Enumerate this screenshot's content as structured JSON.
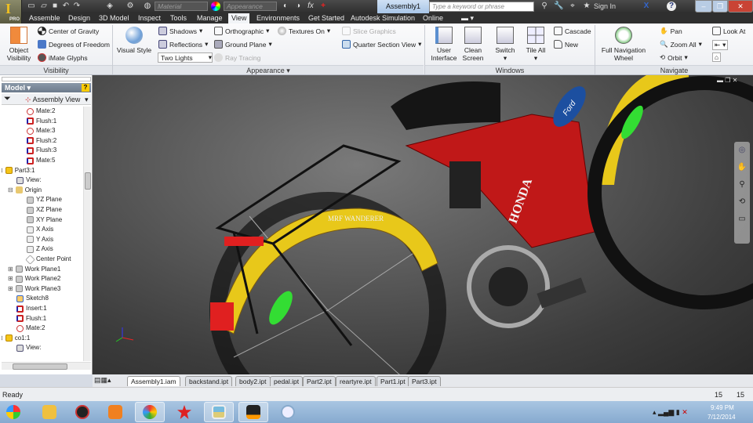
{
  "titlebar": {
    "app_badge": "PRO",
    "material_placeholder": "Material",
    "appearance_placeholder": "Appearance",
    "document_title": "Assembly1",
    "search_placeholder": "Type a keyword or phrase",
    "sign_in": "Sign In"
  },
  "tabs": [
    "Assemble",
    "Design",
    "3D Model",
    "Inspect",
    "Tools",
    "Manage",
    "View",
    "Environments",
    "Get Started",
    "Autodesk Simulation",
    "Online"
  ],
  "active_tab": "View",
  "ribbon": {
    "visibility": {
      "label": "Visibility",
      "object_visibility": "Object Visibility",
      "center_of_gravity": "Center of Gravity",
      "degrees_of_freedom": "Degrees of Freedom",
      "imate_glyphs": "iMate Glyphs"
    },
    "appearance": {
      "label": "Appearance",
      "visual_style": "Visual Style",
      "shadows": "Shadows",
      "reflections": "Reflections",
      "lighting": "Two Lights",
      "orthographic": "Orthographic",
      "ground_plane": "Ground Plane",
      "ray_tracing": "Ray Tracing",
      "textures_on": "Textures On",
      "slice_graphics": "Slice Graphics",
      "quarter_section_view": "Quarter Section View"
    },
    "windows": {
      "label": "Windows",
      "user_interface": "User Interface",
      "clean_screen": "Clean Screen",
      "switch": "Switch",
      "tile_all": "Tile All",
      "cascade": "Cascade",
      "new": "New"
    },
    "navigate": {
      "label": "Navigate",
      "full_navigation_wheel": "Full Navigation Wheel",
      "pan": "Pan",
      "zoom_all": "Zoom All",
      "orbit": "Orbit",
      "look_at": "Look At"
    }
  },
  "browser": {
    "title": "Model",
    "view": "Assembly View",
    "items": [
      {
        "label": "Mate:2",
        "level": 2,
        "icon": "mate"
      },
      {
        "label": "Flush:1",
        "level": 2,
        "icon": "flush"
      },
      {
        "label": "Mate:3",
        "level": 2,
        "icon": "mate"
      },
      {
        "label": "Flush:2",
        "level": 2,
        "icon": "flush"
      },
      {
        "label": "Flush:3",
        "level": 2,
        "icon": "flush"
      },
      {
        "label": "Mate:5",
        "level": 2,
        "icon": "flush"
      },
      {
        "label": "Part3:1",
        "level": 0,
        "icon": "part"
      },
      {
        "label": "View:",
        "level": 1,
        "icon": "view"
      },
      {
        "label": "Origin",
        "level": 1,
        "icon": "folder"
      },
      {
        "label": "YZ Plane",
        "level": 2,
        "icon": "plane"
      },
      {
        "label": "XZ Plane",
        "level": 2,
        "icon": "plane"
      },
      {
        "label": "XY Plane",
        "level": 2,
        "icon": "plane"
      },
      {
        "label": "X Axis",
        "level": 2,
        "icon": "axis"
      },
      {
        "label": "Y Axis",
        "level": 2,
        "icon": "axis"
      },
      {
        "label": "Z Axis",
        "level": 2,
        "icon": "axis"
      },
      {
        "label": "Center Point",
        "level": 2,
        "icon": "point"
      },
      {
        "label": "Work Plane1",
        "level": 1,
        "icon": "plane"
      },
      {
        "label": "Work Plane2",
        "level": 1,
        "icon": "plane"
      },
      {
        "label": "Work Plane3",
        "level": 1,
        "icon": "plane"
      },
      {
        "label": "Sketch8",
        "level": 1,
        "icon": "sketch"
      },
      {
        "label": "Insert:1",
        "level": 1,
        "icon": "flush"
      },
      {
        "label": "Flush:1",
        "level": 1,
        "icon": "flush"
      },
      {
        "label": "Mate:2",
        "level": 1,
        "icon": "mate"
      },
      {
        "label": "co1:1",
        "level": 0,
        "icon": "part"
      },
      {
        "label": "View:",
        "level": 1,
        "icon": "view"
      }
    ]
  },
  "viewport": {
    "decal_brand": "HONDA",
    "decal_ford": "Ford",
    "decal_tyre": "MRF WANDERER"
  },
  "document_tabs": [
    "Assembly1.iam",
    "backstand.ipt",
    "body2.ipt",
    "pedal.ipt",
    "Part2.ipt",
    "reartyre.ipt",
    "Part1.ipt",
    "Part3.ipt"
  ],
  "active_document": "Assembly1.iam",
  "status": {
    "text": "Ready",
    "count1": "15",
    "count2": "15"
  },
  "taskbar": {
    "time": "9:49 PM",
    "date": "7/12/2014"
  }
}
